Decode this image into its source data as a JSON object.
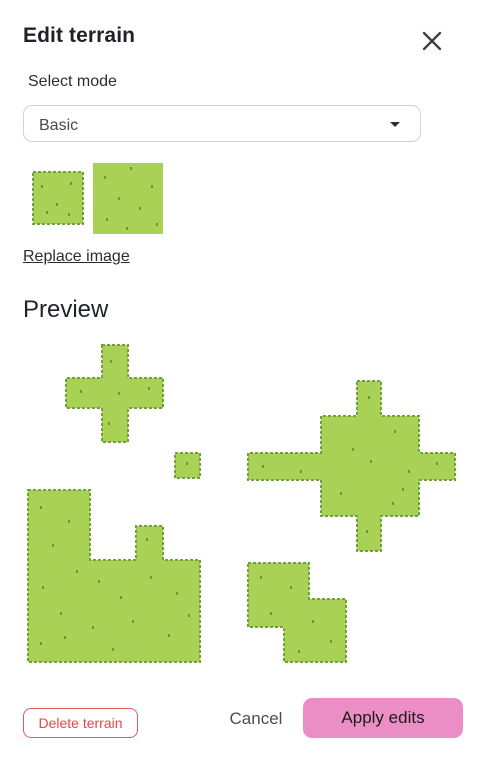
{
  "header": {
    "title": "Edit terrain",
    "close_icon": "close-icon"
  },
  "mode": {
    "label": "Select mode",
    "selected": "Basic",
    "dropdown_icon": "caret-down-icon"
  },
  "tileset": {
    "replace_label": "Replace image"
  },
  "preview": {
    "title": "Preview"
  },
  "footer": {
    "delete_label": "Delete terrain",
    "cancel_label": "Cancel",
    "apply_label": "Apply edits"
  },
  "colors": {
    "grass": "#a8d155",
    "grass_edge": "#6fa33a",
    "grass_speck": "#5f9a35",
    "apply_bg": "#ec8ec6",
    "delete_red": "#e2474a"
  }
}
